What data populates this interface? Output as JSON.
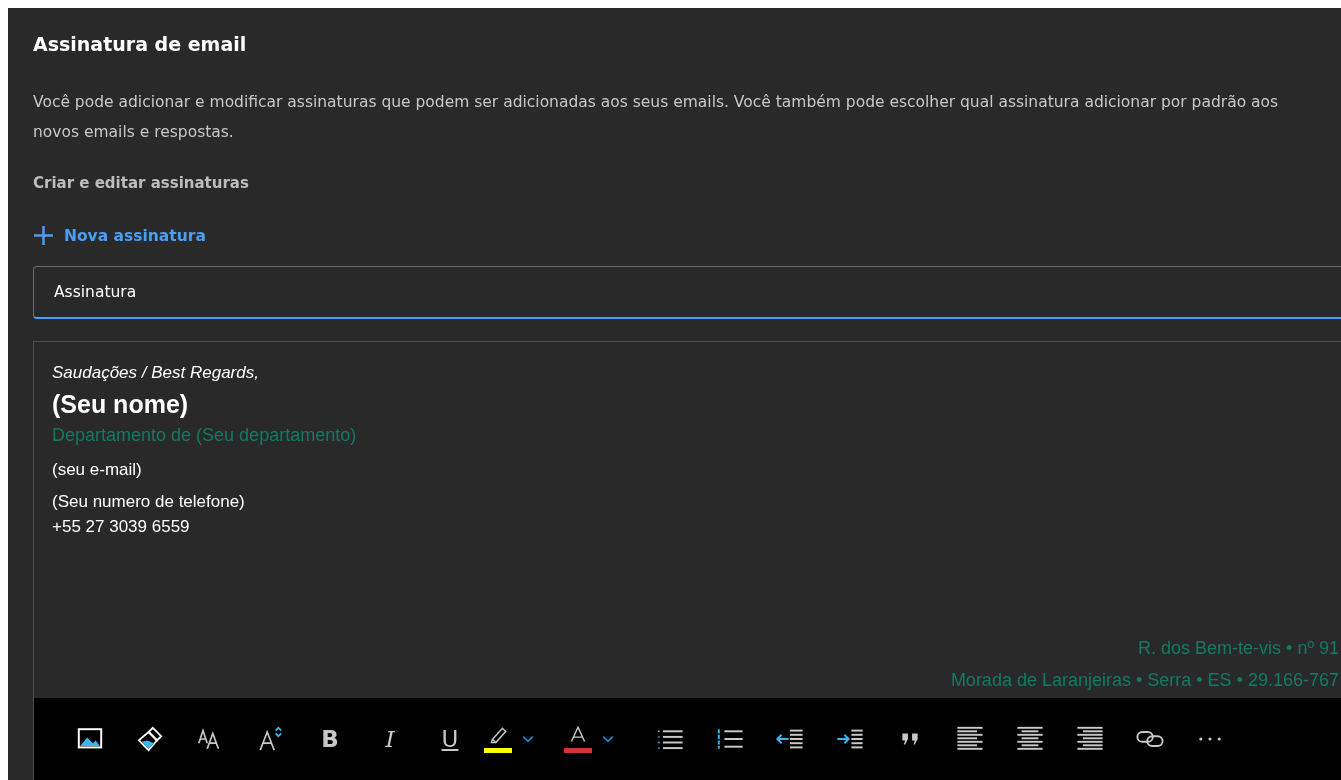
{
  "section": {
    "title": "Assinatura de email",
    "description": "Você pode adicionar e modificar assinaturas que podem ser adicionadas aos seus emails. Você também pode escolher qual assinatura adicionar por padrão aos novos emails e respostas.",
    "subheading": "Criar e editar assinaturas"
  },
  "new_signature_button": {
    "label": "Nova assinatura"
  },
  "name_field": {
    "value": "Assinatura"
  },
  "signature_editor": {
    "lines": [
      {
        "kind": "greeting",
        "text": "Saudações / Best Regards,"
      },
      {
        "kind": "name",
        "text": "(Seu nome)"
      },
      {
        "kind": "department",
        "text": "Departamento de (Seu departamento)"
      },
      {
        "kind": "contact",
        "text": "(seu e-mail)"
      },
      {
        "kind": "contact",
        "text": "(Seu numero de telefone)"
      },
      {
        "kind": "contact-tight",
        "text": "+55 27 3039 6559"
      }
    ],
    "address": [
      "R. dos Bem-te-vis • nº 91",
      "Morada de Laranjeiras • Serra • ES • 29.166-767"
    ]
  },
  "toolbar": [
    {
      "kind": "image"
    },
    {
      "kind": "format-painter"
    },
    {
      "kind": "font-size"
    },
    {
      "kind": "font-size-step"
    },
    {
      "kind": "bold",
      "label": "B"
    },
    {
      "kind": "italic",
      "label": "I"
    },
    {
      "kind": "underline",
      "label": "U"
    },
    {
      "kind": "highlight",
      "color": "#ffff00"
    },
    {
      "kind": "font-color",
      "color": "#d13438"
    },
    {
      "kind": "bullets"
    },
    {
      "kind": "numbering"
    },
    {
      "kind": "outdent"
    },
    {
      "kind": "indent"
    },
    {
      "kind": "quote"
    },
    {
      "kind": "align-left"
    },
    {
      "kind": "align-center"
    },
    {
      "kind": "align-right"
    },
    {
      "kind": "link"
    },
    {
      "kind": "more"
    }
  ]
}
